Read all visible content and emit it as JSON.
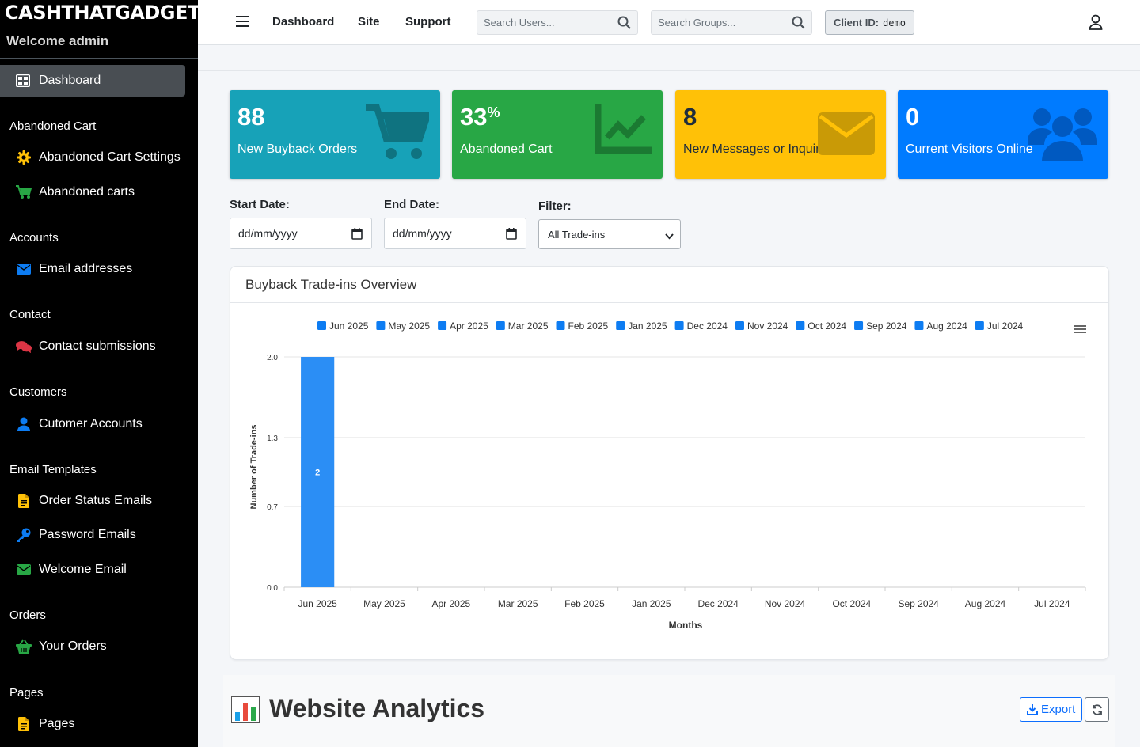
{
  "sidebar": {
    "brand": "CASHTHATGADGET",
    "welcome": "Welcome admin",
    "active_item": "Dashboard",
    "sections": [
      {
        "heading": "Abandoned Cart",
        "items": [
          {
            "label": "Abandoned Cart Settings",
            "icon": "gear-icon"
          },
          {
            "label": "Abandoned carts",
            "icon": "cart-icon"
          }
        ]
      },
      {
        "heading": "Accounts",
        "items": [
          {
            "label": "Email addresses",
            "icon": "envelope-icon"
          }
        ]
      },
      {
        "heading": "Contact",
        "items": [
          {
            "label": "Contact submissions",
            "icon": "comments-icon"
          }
        ]
      },
      {
        "heading": "Customers",
        "items": [
          {
            "label": "Cutomer Accounts",
            "icon": "user-icon"
          }
        ]
      },
      {
        "heading": "Email Templates",
        "items": [
          {
            "label": "Order Status Emails",
            "icon": "file-icon"
          },
          {
            "label": "Password Emails",
            "icon": "key-icon"
          },
          {
            "label": "Welcome Email",
            "icon": "envelope-icon"
          }
        ]
      },
      {
        "heading": "Orders",
        "items": [
          {
            "label": "Your Orders",
            "icon": "basket-icon"
          }
        ]
      },
      {
        "heading": "Pages",
        "items": [
          {
            "label": "Pages",
            "icon": "file-icon"
          }
        ]
      }
    ]
  },
  "topbar": {
    "nav": [
      "Dashboard",
      "Site",
      "Support"
    ],
    "search_users_placeholder": "Search Users...",
    "search_groups_placeholder": "Search Groups...",
    "client_label": "Client ID:",
    "client_value": "demo"
  },
  "stats": [
    {
      "value": "88",
      "suffix": "",
      "label": "New Buyback Orders",
      "color": "#17a2b8",
      "icon": "cart-icon"
    },
    {
      "value": "33",
      "suffix": "%",
      "label": "Abandoned Cart",
      "color": "#28a745",
      "icon": "chart-line-icon"
    },
    {
      "value": "8",
      "suffix": "",
      "label": "New Messages or Inquiries",
      "color": "#ffc107",
      "icon": "envelope-icon"
    },
    {
      "value": "0",
      "suffix": "",
      "label": "Current Visitors Online",
      "color": "#007bff",
      "icon": "users-icon"
    }
  ],
  "filters": {
    "start_label": "Start Date:",
    "start_value": "dd/mm/yyyy",
    "end_label": "End Date:",
    "end_value": "dd/mm/yyyy",
    "filter_label": "Filter:",
    "filter_value": "All Trade-ins"
  },
  "chart_card": {
    "title": "Buyback Trade-ins Overview"
  },
  "chart_data": {
    "type": "bar",
    "title": "",
    "categories": [
      "Jun 2025",
      "May 2025",
      "Apr 2025",
      "Mar 2025",
      "Feb 2025",
      "Jan 2025",
      "Dec 2024",
      "Nov 2024",
      "Oct 2024",
      "Sep 2024",
      "Aug 2024",
      "Jul 2024"
    ],
    "values": [
      2,
      0,
      0,
      0,
      0,
      0,
      0,
      0,
      0,
      0,
      0,
      0
    ],
    "legend": [
      "Jun 2025",
      "May 2025",
      "Apr 2025",
      "Mar 2025",
      "Feb 2025",
      "Jan 2025",
      "Dec 2024",
      "Nov 2024",
      "Oct 2024",
      "Sep 2024",
      "Aug 2024",
      "Jul 2024"
    ],
    "legend_placement": "top",
    "xlabel": "Months",
    "ylabel": "Number of Trade-ins",
    "yticks": [
      "0.0",
      "0.7",
      "1.3",
      "2.0"
    ],
    "ylim": [
      0,
      2
    ],
    "data_labels": [
      "2"
    ],
    "grid": true,
    "bar_color": "#2b8ef5",
    "legend_color": "#0d7cf2"
  },
  "analytics": {
    "title": "Website Analytics",
    "export_label": "Export"
  }
}
